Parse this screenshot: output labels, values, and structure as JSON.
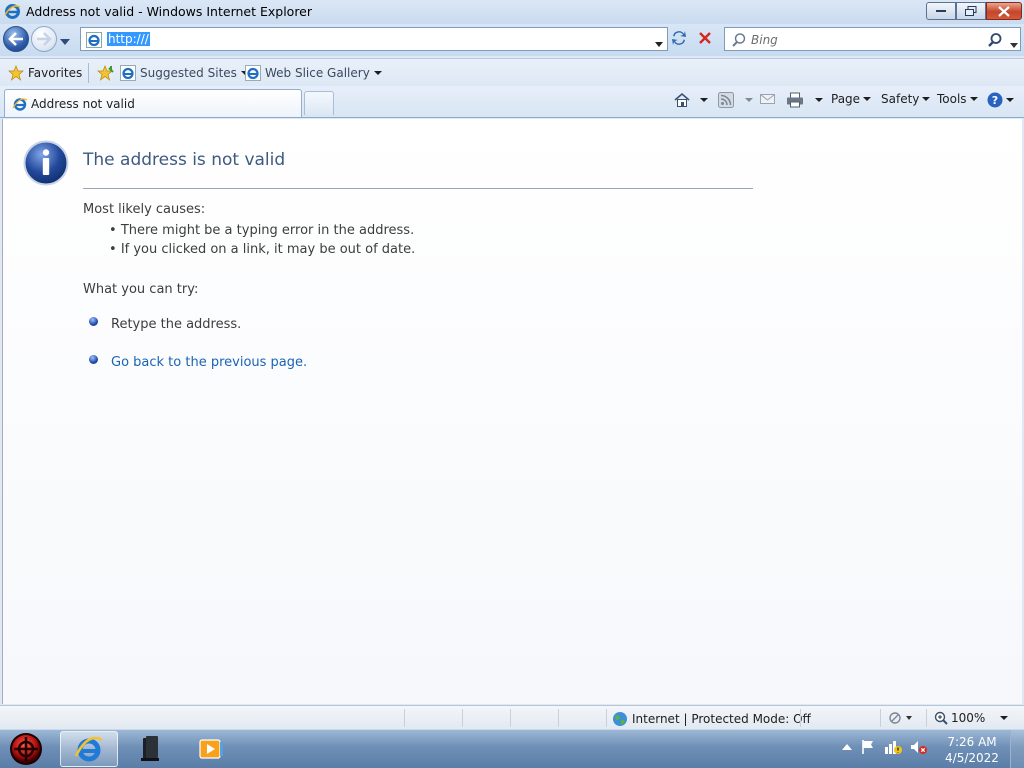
{
  "window": {
    "title": "Address not valid - Windows Internet Explorer"
  },
  "nav": {
    "address_value": "http:///",
    "search_placeholder": "Bing"
  },
  "favorites_bar": {
    "favorites_label": "Favorites",
    "items": [
      {
        "label": "Suggested Sites"
      },
      {
        "label": "Web Slice Gallery"
      }
    ]
  },
  "tab": {
    "active_label": "Address not valid"
  },
  "command_bar": {
    "page_label": "Page",
    "safety_label": "Safety",
    "tools_label": "Tools"
  },
  "content": {
    "title": "The address is not valid",
    "causes_heading": "Most likely causes:",
    "causes": [
      "There might be a typing error in the address.",
      "If you clicked on a link, it may be out of date."
    ],
    "try_heading": "What you can try:",
    "try_items": [
      "Retype the address.",
      "Go back to the previous page."
    ]
  },
  "status_bar": {
    "zone_text": "Internet | Protected Mode: Off",
    "zoom": "100%"
  },
  "taskbar": {
    "time": "7:26 AM",
    "date": "4/5/2022"
  },
  "colors": {
    "title_text": "#3d5a80",
    "link": "#1a64b5",
    "close_button": "#c6452a"
  }
}
